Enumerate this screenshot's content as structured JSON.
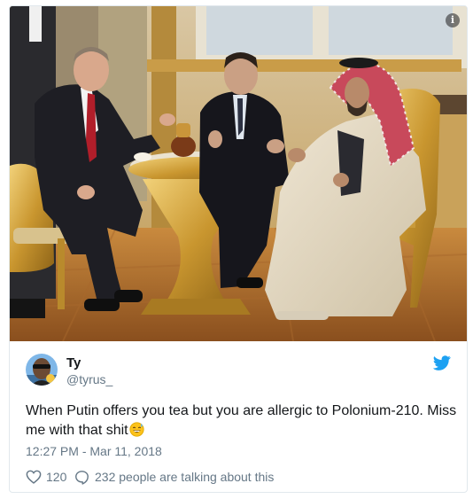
{
  "tweet": {
    "display_name": "Ty",
    "handle": "@tyrus_",
    "text": "When Putin offers you tea but you are allergic to Polonium-210. Miss me with that shit",
    "emoji": "sweat-smile-emoji",
    "timestamp": "12:27 PM - Mar 11, 2018",
    "like_count": "120",
    "talking_text": "232 people are talking about this"
  },
  "media": {
    "info_glyph": "i",
    "description_icon": "photo-of-tea-meeting"
  },
  "icons": {
    "info": "info-icon",
    "bird": "twitter-bird-icon",
    "heart": "heart-icon",
    "reply": "speech-bubble-icon"
  },
  "colors": {
    "twitter_blue": "#1da1f2",
    "text_primary": "#14171a",
    "text_secondary": "#657786",
    "border": "#e1e8ed"
  }
}
